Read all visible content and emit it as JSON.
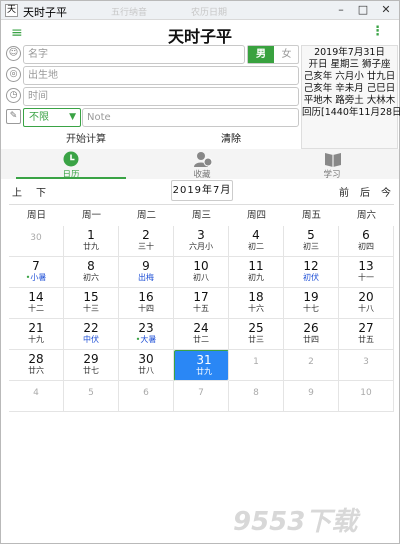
{
  "window": {
    "title": "天时子平",
    "ghost1": "五行纳音",
    "ghost2": "农历日期",
    "btn_min": "–",
    "btn_max": "□",
    "btn_close": "✕"
  },
  "header": {
    "title": "天时子平",
    "menu_icon": "≡",
    "more_icon": "⋮"
  },
  "form": {
    "name_placeholder": "名字",
    "birthplace_placeholder": "出生地",
    "time_placeholder": "时间",
    "select_value": "不限",
    "note_placeholder": "Note",
    "gender_male": "男",
    "gender_female": "女",
    "calc_label": "开始计算",
    "clear_label": "清除"
  },
  "info": [
    "2019年7月31日",
    "开日 星期三 狮子座",
    "己亥年 六月小 廿九日",
    "己亥年 辛未月 己巳日",
    "平地木 路旁土 大林木",
    "回历[1440年11月28日]"
  ],
  "tabs": [
    {
      "label": "日历",
      "icon": "clock-icon"
    },
    {
      "label": "收藏",
      "icon": "person-clock-icon"
    },
    {
      "label": "学习",
      "icon": "book-icon"
    }
  ],
  "nav": {
    "prev_year": "上",
    "next_year": "下",
    "current": "2019年7月",
    "prev_month": "前",
    "next_month": "后",
    "today": "今"
  },
  "weekdays": [
    "周日",
    "周一",
    "周二",
    "周三",
    "周四",
    "周五",
    "周六"
  ],
  "days": [
    [
      {
        "d": "30",
        "l": "",
        "dim": true
      },
      {
        "d": "1",
        "l": "廿九"
      },
      {
        "d": "2",
        "l": "三十"
      },
      {
        "d": "3",
        "l": "六月小"
      },
      {
        "d": "4",
        "l": "初二"
      },
      {
        "d": "5",
        "l": "初三"
      },
      {
        "d": "6",
        "l": "初四"
      }
    ],
    [
      {
        "d": "7",
        "l": "小暑",
        "blue": true,
        "dot": true
      },
      {
        "d": "8",
        "l": "初六"
      },
      {
        "d": "9",
        "l": "出梅",
        "blue": true
      },
      {
        "d": "10",
        "l": "初八"
      },
      {
        "d": "11",
        "l": "初九"
      },
      {
        "d": "12",
        "l": "初伏",
        "blue": true
      },
      {
        "d": "13",
        "l": "十一"
      }
    ],
    [
      {
        "d": "14",
        "l": "十二"
      },
      {
        "d": "15",
        "l": "十三"
      },
      {
        "d": "16",
        "l": "十四"
      },
      {
        "d": "17",
        "l": "十五"
      },
      {
        "d": "18",
        "l": "十六"
      },
      {
        "d": "19",
        "l": "十七"
      },
      {
        "d": "20",
        "l": "十八"
      }
    ],
    [
      {
        "d": "21",
        "l": "十九"
      },
      {
        "d": "22",
        "l": "中伏",
        "blue": true
      },
      {
        "d": "23",
        "l": "大暑",
        "blue": true,
        "dot": true
      },
      {
        "d": "24",
        "l": "廿二"
      },
      {
        "d": "25",
        "l": "廿三"
      },
      {
        "d": "26",
        "l": "廿四"
      },
      {
        "d": "27",
        "l": "廿五"
      }
    ],
    [
      {
        "d": "28",
        "l": "廿六"
      },
      {
        "d": "29",
        "l": "廿七"
      },
      {
        "d": "30",
        "l": "廿八"
      },
      {
        "d": "31",
        "l": "廿九",
        "selected": true
      },
      {
        "d": "1",
        "l": "",
        "dim": true
      },
      {
        "d": "2",
        "l": "",
        "dim": true
      },
      {
        "d": "3",
        "l": "",
        "dim": true
      }
    ],
    [
      {
        "d": "4",
        "l": "",
        "dim": true
      },
      {
        "d": "5",
        "l": "",
        "dim": true
      },
      {
        "d": "6",
        "l": "",
        "dim": true
      },
      {
        "d": "7",
        "l": "",
        "dim": true
      },
      {
        "d": "8",
        "l": "",
        "dim": true
      },
      {
        "d": "9",
        "l": "",
        "dim": true
      },
      {
        "d": "10",
        "l": "",
        "dim": true
      }
    ]
  ],
  "watermark": "9553下载",
  "colors": {
    "accent": "#3aa345",
    "selected": "#2a87f5",
    "festival": "#1e4fd6"
  }
}
